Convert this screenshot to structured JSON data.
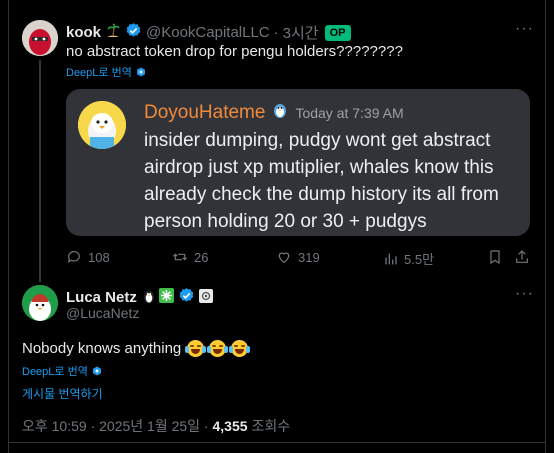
{
  "tweet1": {
    "author_name": "kook",
    "handle": "@KookCapitalLLC",
    "separator": "·",
    "time": "3시간",
    "op_badge": "OP",
    "text": "no abstract token drop for pengu holders????????",
    "deepl_label": "DeepL로 번역",
    "card": {
      "username": "DoyouHateme",
      "timestamp": "Today at 7:39 AM",
      "message": "insider dumping, pudgy wont get abstract airdrop just xp mutiplier, whales know this already check the dump history its all from person holding 20 or 30 + pudgys"
    },
    "actions": {
      "replies": "108",
      "reposts": "26",
      "likes": "319",
      "views": "5.5만"
    }
  },
  "tweet2": {
    "author_name": "Luca Netz",
    "handle": "@LucaNetz",
    "text": "Nobody knows anything",
    "deepl_label": "DeepL로 번역",
    "translate_post": "게시물 번역하기",
    "time": "오후 10:59 · 2025년 1월 25일 ·",
    "views_count": "4,355",
    "views_label": "조회수"
  },
  "colors": {
    "background": "#000000",
    "accent": "#1d9bf0",
    "op_badge": "#00ba7c",
    "discord_username": "#f08a3a",
    "card_bg": "#323339"
  }
}
